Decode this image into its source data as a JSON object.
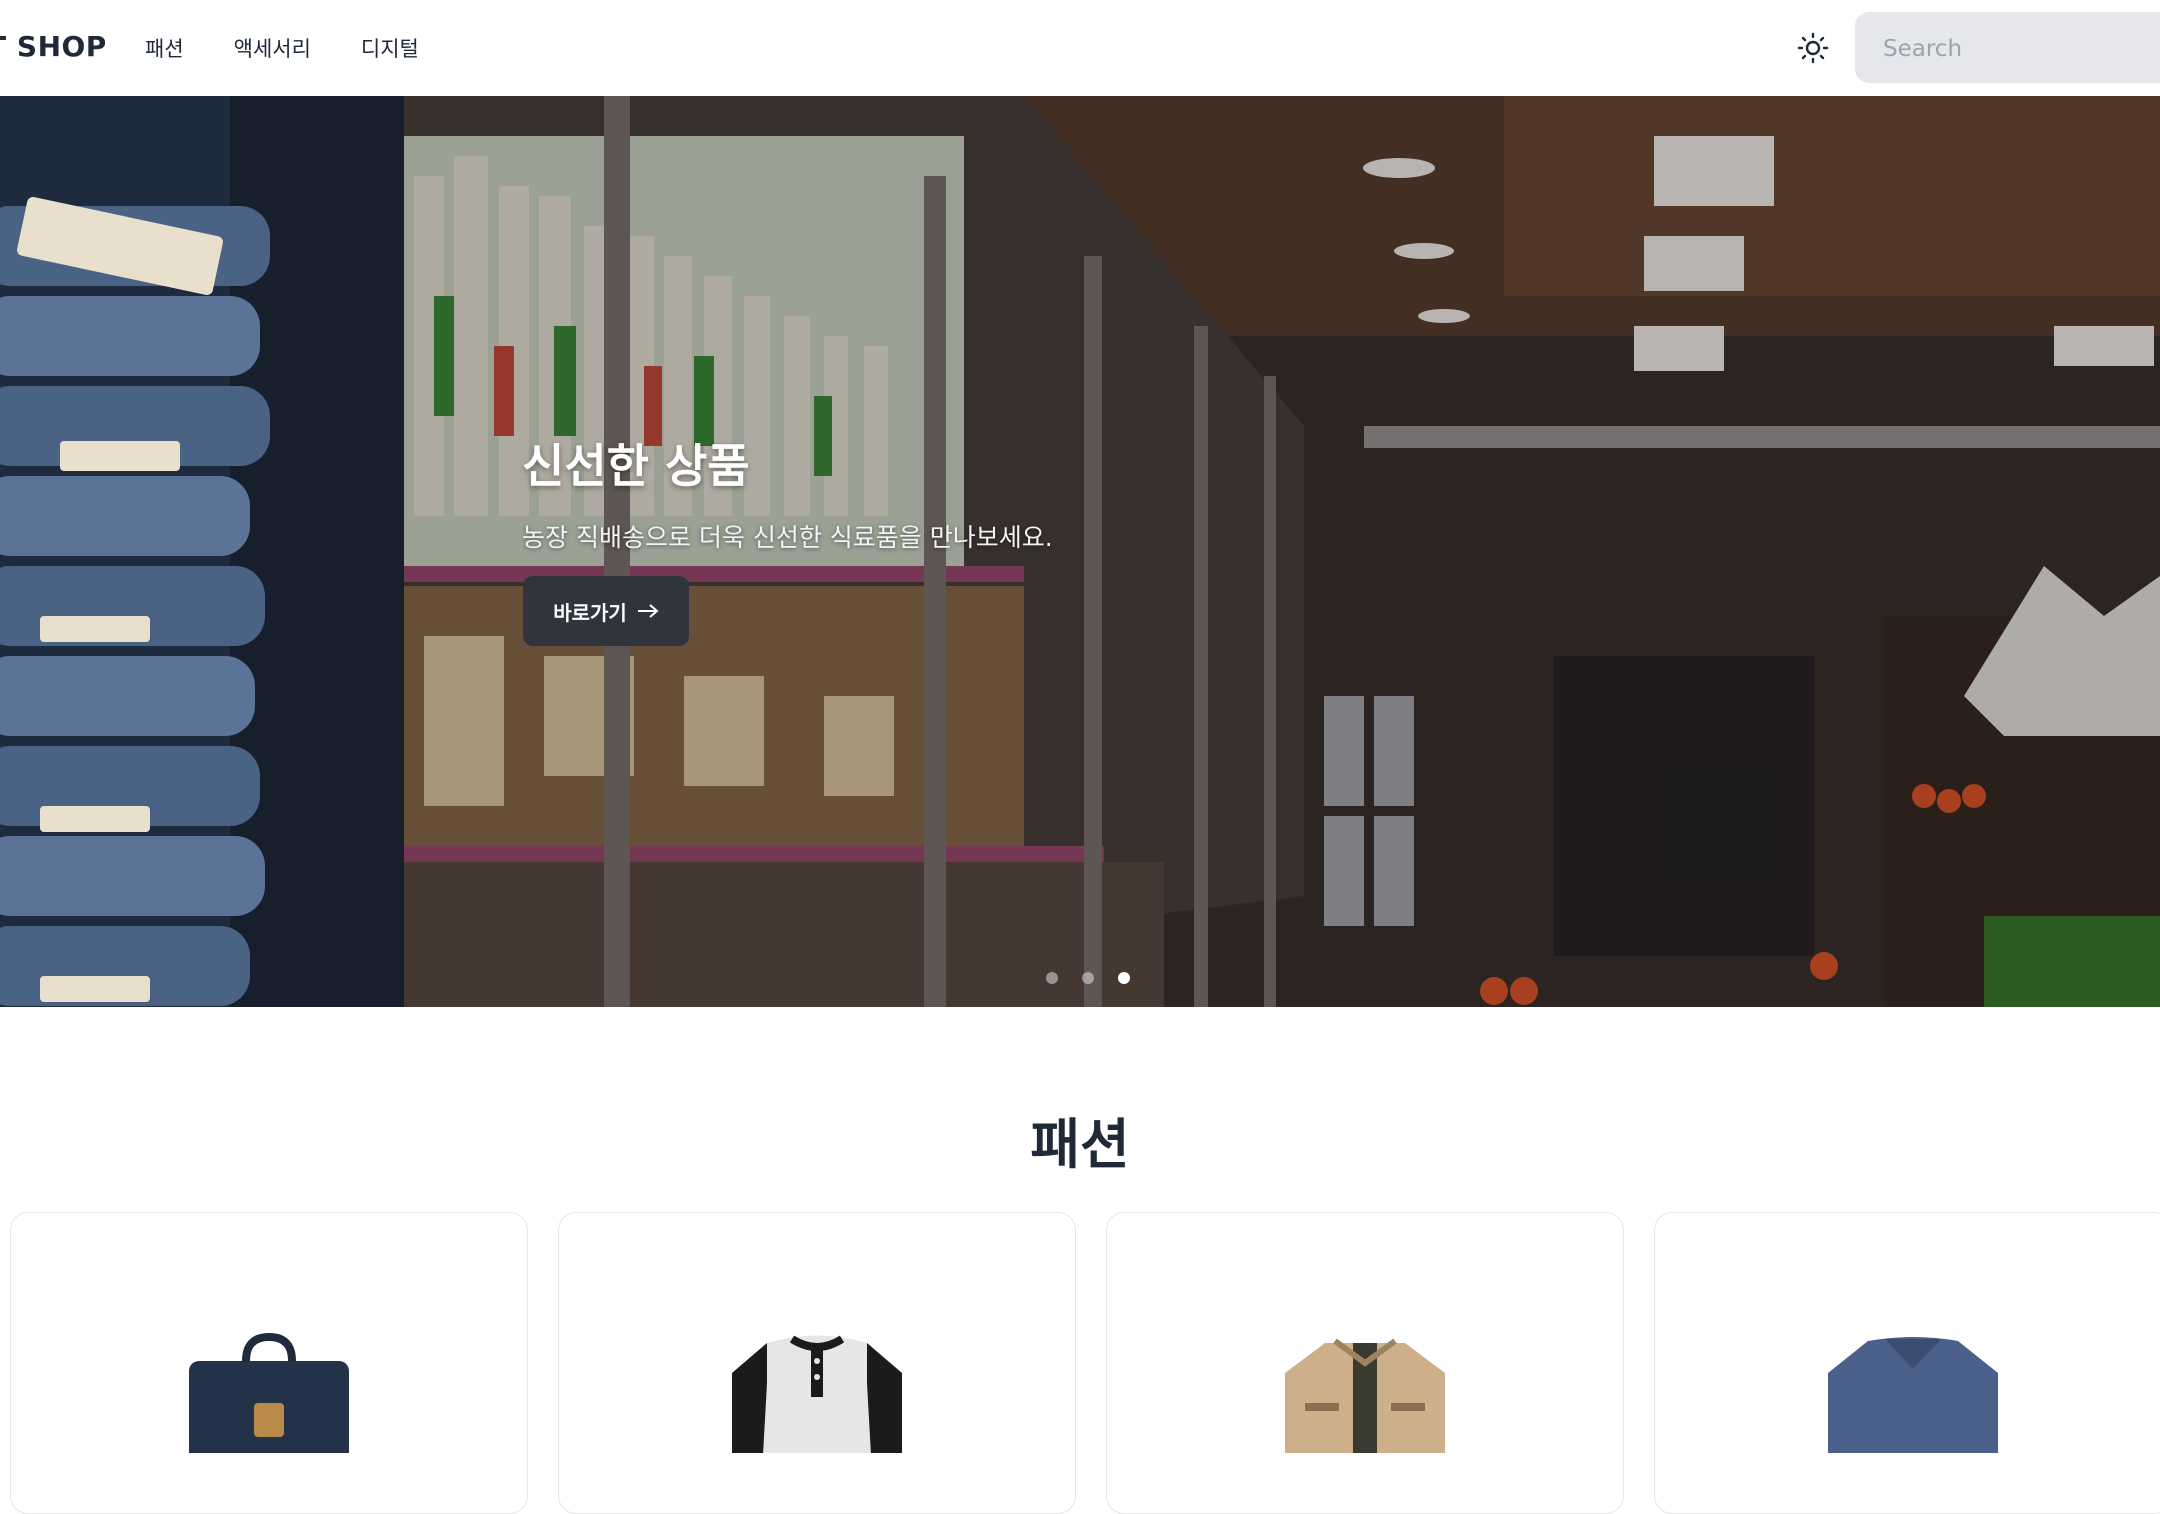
{
  "header": {
    "brand": "CT SHOP",
    "nav": [
      "패션",
      "액세서리",
      "디지털"
    ],
    "theme_icon": "sun-icon",
    "search_placeholder": "Search"
  },
  "hero": {
    "title": "신선한 상품",
    "subtitle": "농장 직배송으로 더욱 신선한 식료품을 만나보세요.",
    "button_label": "바로가기",
    "button_icon": "arrow-right-icon",
    "slide_count": 3,
    "active_slide": 3
  },
  "section": {
    "title": "패션",
    "products": [
      {
        "icon": "backpack-icon"
      },
      {
        "icon": "henley-shirt-icon"
      },
      {
        "icon": "jacket-icon"
      },
      {
        "icon": "sweater-icon"
      }
    ]
  },
  "colors": {
    "header_bg": "#ffffff",
    "text": "#1f2937",
    "search_bg": "#e5e7eb",
    "hero_button_bg": "#2f343d"
  }
}
